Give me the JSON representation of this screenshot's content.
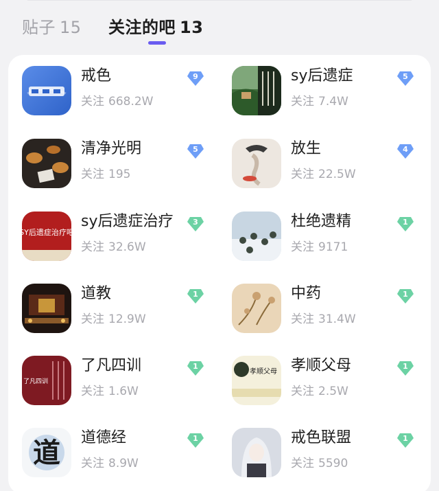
{
  "tabs": [
    {
      "label": "贴子",
      "count": "15"
    },
    {
      "label": "关注的吧",
      "count": "13"
    }
  ],
  "colors": {
    "accent": "#6a5cf0",
    "level_blue": "#6e9ef7",
    "level_green": "#6cd2a4"
  },
  "fans_label": "关注",
  "bars": [
    {
      "name": "戒色",
      "fans": "668.2W",
      "level": "9",
      "level_color": "blue",
      "icon": "jiese-ba-logo"
    },
    {
      "name": "sy后遗症",
      "fans": "7.4W",
      "level": "5",
      "level_color": "blue",
      "icon": "landscape-calligraphy-image"
    },
    {
      "name": "清净光明",
      "fans": "195",
      "level": "5",
      "level_color": "blue",
      "icon": "tea-cups-image"
    },
    {
      "name": "放生",
      "fans": "22.5W",
      "level": "4",
      "level_color": "blue",
      "icon": "ink-painting-figure-image"
    },
    {
      "name": "sy后遗症治疗",
      "fans": "32.6W",
      "level": "3",
      "level_color": "green",
      "icon": "sy-treatment-red-banner",
      "icon_text": "SY后遗症治疗吧"
    },
    {
      "name": "杜绝遗精",
      "fans": "9171",
      "level": "1",
      "level_color": "green",
      "icon": "snow-soldiers-image"
    },
    {
      "name": "道教",
      "fans": "12.9W",
      "level": "1",
      "level_color": "green",
      "icon": "taoist-temple-image"
    },
    {
      "name": "中药",
      "fans": "31.4W",
      "level": "1",
      "level_color": "green",
      "icon": "herbal-flowers-image"
    },
    {
      "name": "了凡四训",
      "fans": "1.6W",
      "level": "1",
      "level_color": "green",
      "icon": "liaofan-book-cover",
      "icon_text": "了凡四训"
    },
    {
      "name": "孝顺父母",
      "fans": "2.5W",
      "level": "1",
      "level_color": "green",
      "icon": "filial-piety-banner",
      "icon_text": "孝顺父母"
    },
    {
      "name": "道德经",
      "fans": "8.9W",
      "level": "1",
      "level_color": "green",
      "icon": "dao-calligraphy-logo",
      "icon_text": "道"
    },
    {
      "name": "戒色联盟",
      "fans": "5590",
      "level": "1",
      "level_color": "green",
      "icon": "anime-girl-image"
    }
  ]
}
